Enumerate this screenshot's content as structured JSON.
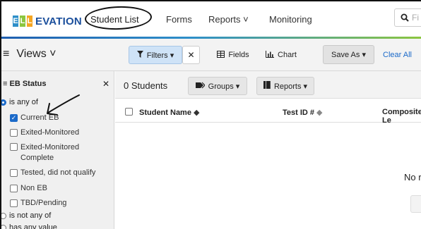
{
  "nav": {
    "logo_letters": [
      "E",
      "L",
      "L"
    ],
    "logo_text": "EVATION",
    "items": [
      {
        "label": "Student List"
      },
      {
        "label": "Forms"
      },
      {
        "label": "Reports ˅"
      },
      {
        "label": "Monitoring"
      }
    ],
    "search_placeholder": "Fi"
  },
  "toolbar": {
    "views_label": "Views ˅",
    "filters_label": "Filters ▾",
    "clear_x": "✕",
    "fields_label": "Fields",
    "chart_label": "Chart",
    "save_as_label": "Save As ▾",
    "clear_all_label": "Clear All"
  },
  "filter_panel": {
    "title": "EB Status",
    "close": "✕",
    "mode_is_any_of": "is any of",
    "options": [
      {
        "label": "Current EB",
        "checked": true
      },
      {
        "label": "Exited-Monitored",
        "checked": false
      },
      {
        "label": "Exited-Monitored Complete",
        "checked": false
      },
      {
        "label": "Tested, did not qualify",
        "checked": false
      },
      {
        "label": "Non EB",
        "checked": false
      },
      {
        "label": "TBD/Pending",
        "checked": false
      }
    ],
    "mode_is_not_any_of": "is not any of",
    "mode_has_any_value": "has any value"
  },
  "main": {
    "student_count": "0 Students",
    "groups_label": "Groups ▾",
    "reports_label": "Reports ▾",
    "columns": [
      {
        "label": "Student Name"
      },
      {
        "label": "Test ID #"
      },
      {
        "label": "Composite Le"
      }
    ],
    "empty_message": "No res"
  },
  "colors": {
    "accent_blue": "#1b6ac9",
    "logo_blue": "#1b4f9c",
    "logo_blocks": [
      "#2e8fc9",
      "#8cc63f",
      "#f5a623"
    ]
  }
}
